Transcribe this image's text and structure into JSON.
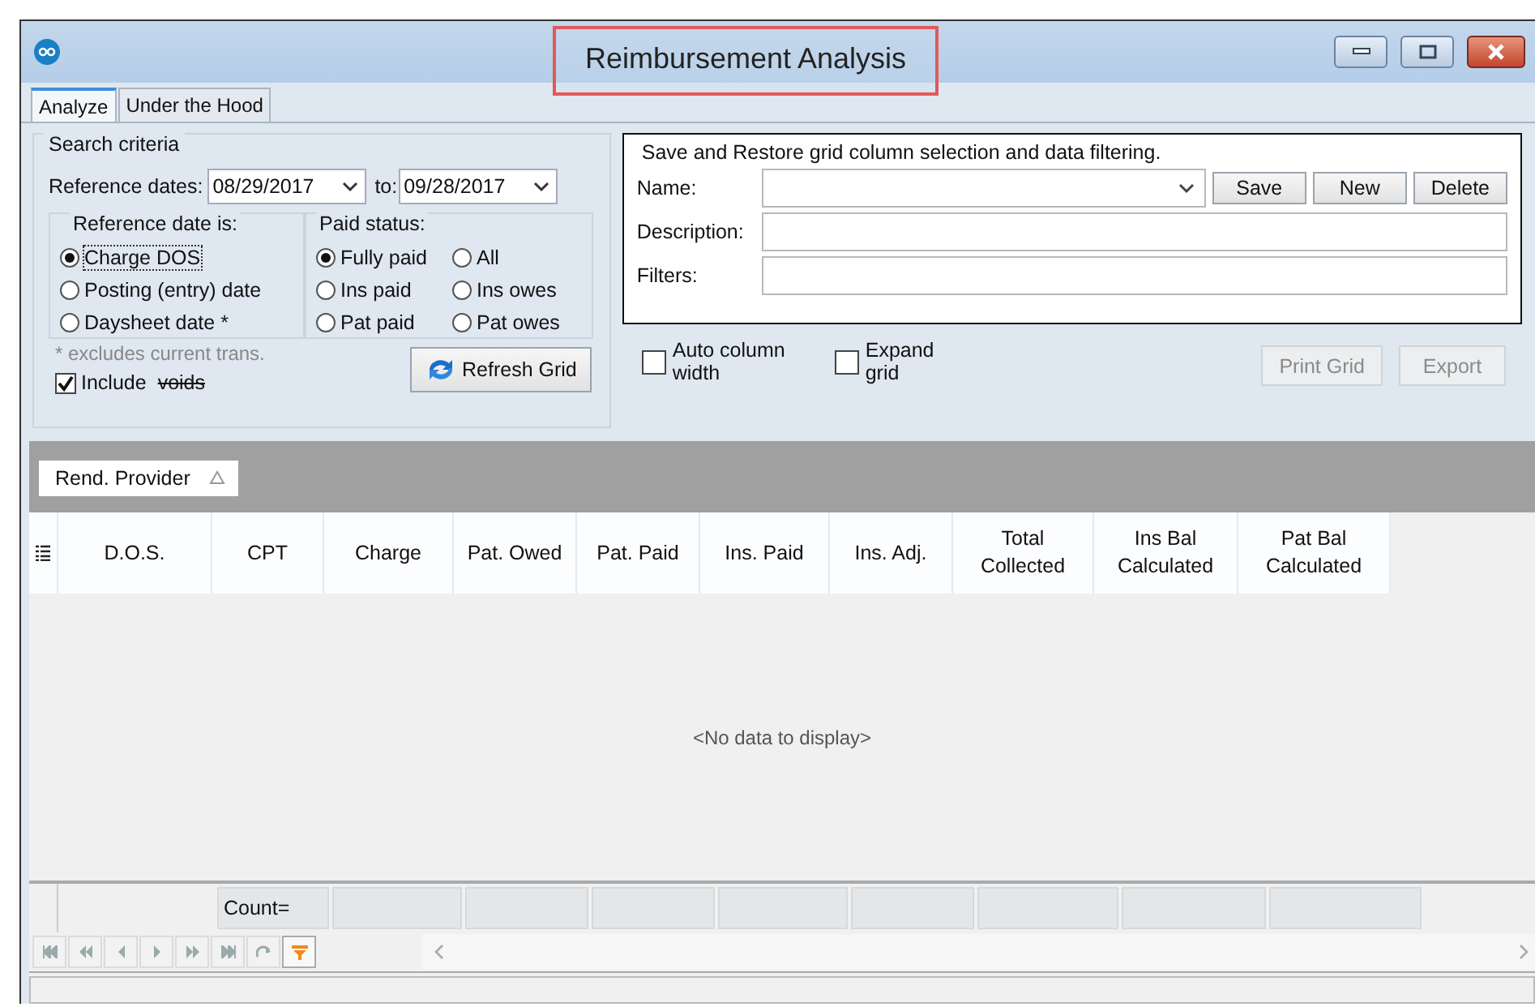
{
  "window": {
    "title": "Reimbursement Analysis"
  },
  "tabs": [
    {
      "label": "Analyze",
      "selected": true
    },
    {
      "label": "Under the Hood",
      "selected": false
    }
  ],
  "search_criteria": {
    "title": "Search criteria",
    "reference_dates_label": "Reference dates:",
    "from_date": "08/29/2017",
    "to_label": "to:",
    "to_date": "09/28/2017",
    "reference_date_is": {
      "title": "Reference date is:",
      "options": [
        {
          "label": "Charge DOS",
          "selected": true
        },
        {
          "label": "Posting (entry) date",
          "selected": false
        },
        {
          "label": "Daysheet date *",
          "selected": false
        }
      ]
    },
    "paid_status": {
      "title": "Paid status:",
      "options": [
        {
          "label": "Fully paid",
          "selected": true
        },
        {
          "label": "All",
          "selected": false
        },
        {
          "label": "Ins paid",
          "selected": false
        },
        {
          "label": "Ins owes",
          "selected": false
        },
        {
          "label": "Pat paid",
          "selected": false
        },
        {
          "label": "Pat owes",
          "selected": false
        }
      ]
    },
    "note": "* excludes current trans.",
    "include_voids": {
      "label": "Include",
      "struck_text": "voids",
      "checked": true
    },
    "refresh_button": "Refresh Grid"
  },
  "saved_layouts": {
    "title": "Save and Restore grid column selection and data filtering.",
    "name_label": "Name:",
    "buttons": [
      "Save",
      "New",
      "Delete"
    ],
    "description_label": "Description:",
    "filters_label": "Filters:"
  },
  "options": [
    {
      "label": "Auto column width",
      "checked": false
    },
    {
      "label": "Expand grid",
      "checked": false
    }
  ],
  "actions": [
    {
      "label": "Print Grid",
      "disabled": true
    },
    {
      "label": "Export",
      "disabled": true
    }
  ],
  "group_by": [
    {
      "label": "Rend. Provider"
    }
  ],
  "grid": {
    "columns": [
      {
        "label": "D.O.S."
      },
      {
        "label": "CPT",
        "summary": "Count="
      },
      {
        "label": "Charge"
      },
      {
        "label": "Pat. Owed"
      },
      {
        "label": "Pat. Paid"
      },
      {
        "label": "Ins. Paid"
      },
      {
        "label": "Ins. Adj."
      },
      {
        "label": "Total Collected"
      },
      {
        "label": "Ins Bal Calculated"
      },
      {
        "label": "Pat Bal Calculated"
      }
    ],
    "empty_text": "<No data to display>"
  }
}
